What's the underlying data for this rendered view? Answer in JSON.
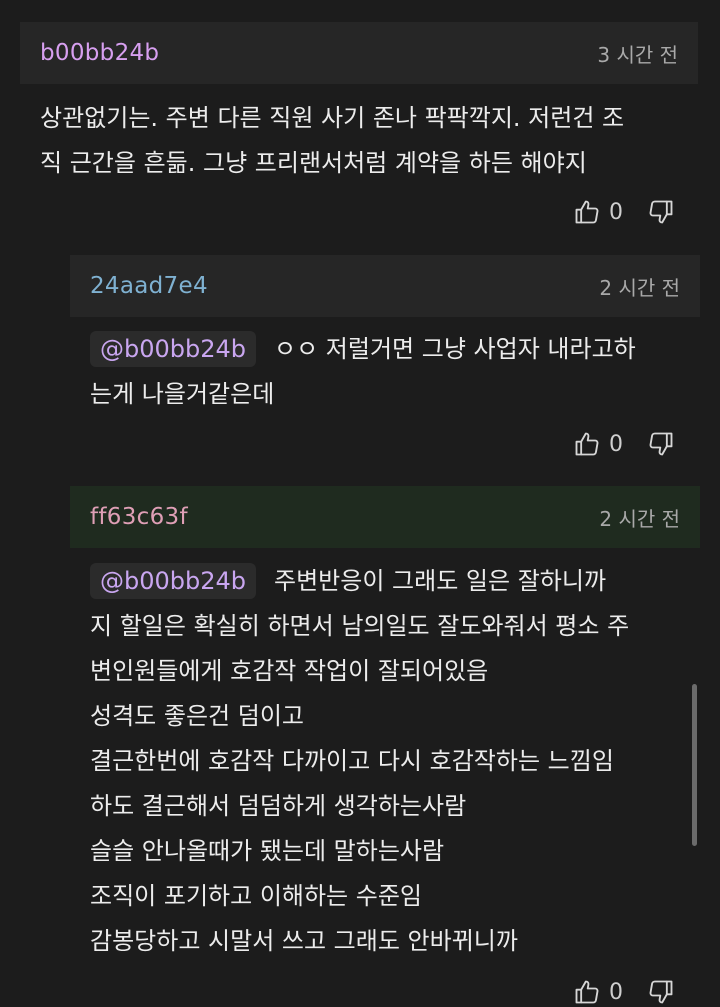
{
  "comments": [
    {
      "user": "b00bb24b",
      "time": "3 시간 전",
      "lines": [
        "상관없기는. 주변 다른 직원 사기 존나 팍팍깍지. 저런건 조",
        "직 근간을 흔듦. 그냥 프리랜서처럼 계약을 하든 해야지"
      ],
      "likes": "0"
    },
    {
      "user": "24aad7e4",
      "time": "2 시간 전",
      "mention": "@b00bb24b",
      "first_line": "ㅇㅇ 저럴거면 그냥 사업자 내라고하",
      "lines": [
        "는게 나을거같은데"
      ],
      "likes": "0"
    },
    {
      "user": "ff63c63f",
      "time": "2 시간 전",
      "mention": "@b00bb24b",
      "first_line": "주변반응이 그래도 일은 잘하니까",
      "lines": [
        "지 할일은 확실히 하면서 남의일도 잘도와줘서 평소 주",
        "변인원들에게 호감작 작업이 잘되어있음",
        "성격도 좋은건 덤이고",
        "결근한번에 호감작 다까이고 다시 호감작하는 느낌임",
        "하도 결근해서 덤덤하게 생각하는사람",
        "슬슬 안나올때가 됐는데 말하는사람",
        "조직이 포기하고 이해하는 수준임",
        "감봉당하고 시말서 쓰고 그래도 안바뀌니까"
      ],
      "likes": "0"
    }
  ],
  "icons": {
    "like": "thumbs-up-icon",
    "dislike": "thumbs-down-icon"
  },
  "colors": {
    "user1": "#d79ff0",
    "user2": "#7fb1d1",
    "user3": "#df9fb6",
    "mention": "#c9a6f0"
  }
}
